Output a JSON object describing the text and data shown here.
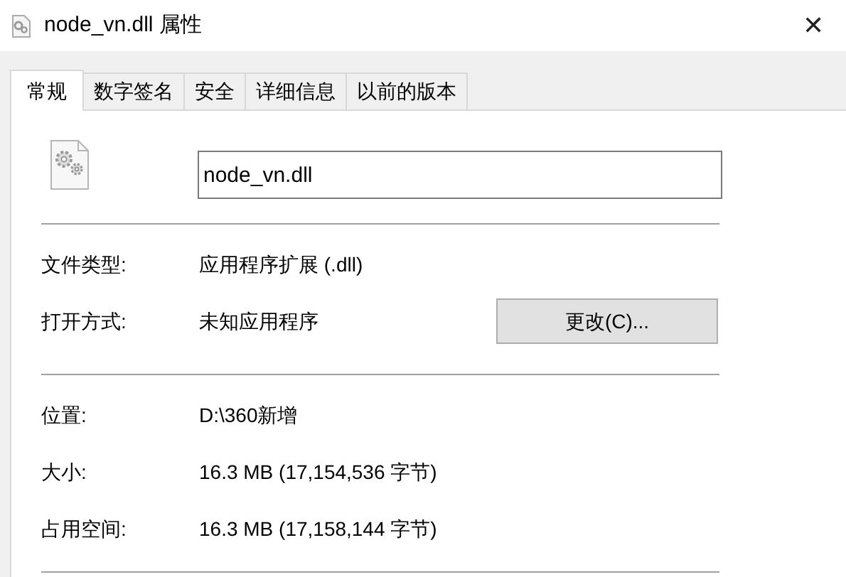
{
  "window": {
    "title": "node_vn.dll 属性",
    "close": "✕"
  },
  "tabs": [
    {
      "label": "常规",
      "selected": true
    },
    {
      "label": "数字签名",
      "selected": false
    },
    {
      "label": "安全",
      "selected": false
    },
    {
      "label": "详细信息",
      "selected": false
    },
    {
      "label": "以前的版本",
      "selected": false
    }
  ],
  "file_name": {
    "value": "node_vn.dll"
  },
  "groups": [
    [
      {
        "label": "文件类型:",
        "value": "应用程序扩展 (.dll)"
      },
      {
        "label": "打开方式:",
        "value": "未知应用程序",
        "button": "更改(C)..."
      }
    ],
    [
      {
        "label": "位置:",
        "value": "D:\\360新增"
      },
      {
        "label": "大小:",
        "value": "16.3 MB (17,154,536 字节)"
      },
      {
        "label": "占用空间:",
        "value": "16.3 MB (17,158,144 字节)"
      }
    ]
  ]
}
